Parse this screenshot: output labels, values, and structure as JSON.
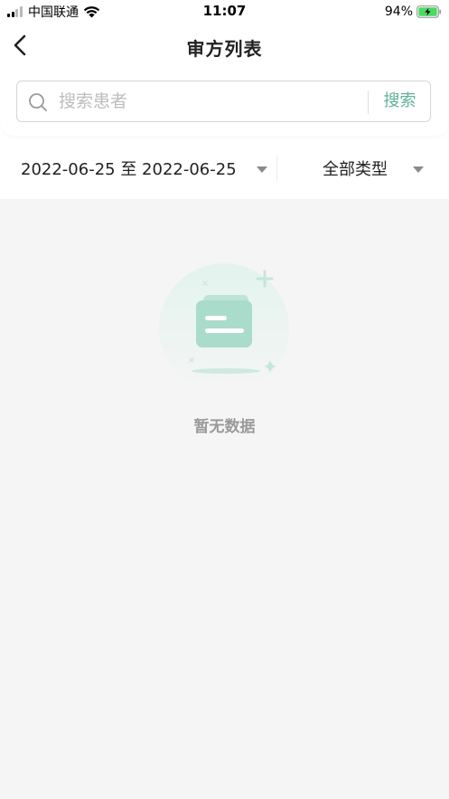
{
  "status_bar": {
    "carrier": "中国联通",
    "time": "11:07",
    "battery": "94%",
    "signal_bars_active": 2,
    "signal_bars_total": 4
  },
  "nav": {
    "title": "审方列表",
    "back_icon": "chevron-left-icon"
  },
  "search": {
    "placeholder": "搜索患者",
    "value": "",
    "button_label": "搜索"
  },
  "filters": {
    "date_range": "2022-06-25 至 2022-06-25",
    "type": "全部类型"
  },
  "empty_state": {
    "icon": "empty-folder-icon",
    "text": "暂无数据"
  },
  "colors": {
    "accent": "#5fb394",
    "illustration": "#a9dccb",
    "background": "#f5f5f5",
    "battery_fill": "#4cd964"
  }
}
